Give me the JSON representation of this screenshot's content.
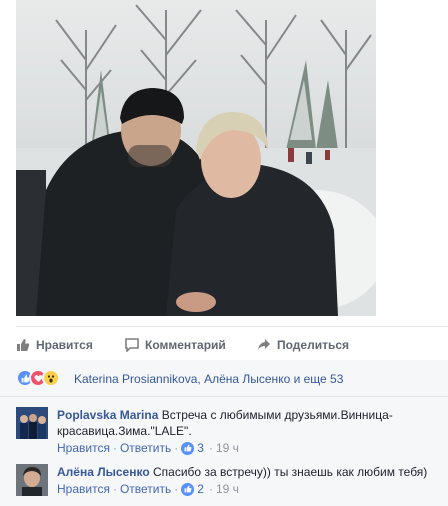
{
  "actions": {
    "like_label": "Нравится",
    "comment_label": "Комментарий",
    "share_label": "Поделиться"
  },
  "reactions": {
    "names_text": "Katerina Prosiannikova, Алёна Лысенко и еще 53",
    "types": [
      "like-icon",
      "love-icon",
      "wow-icon"
    ]
  },
  "comments": [
    {
      "author": "Poplavska Marina",
      "text": "Встреча с любимыми друзьями.Винница-красавица.Зима.\"LALE\".",
      "like_link": "Нравится",
      "reply_link": "Ответить",
      "likes_count": "3",
      "time": "19 ч"
    },
    {
      "author": "Алёна Лысенко",
      "text": "Спасибо за встречу)) ты знаешь как любим тебя)",
      "like_link": "Нравится",
      "reply_link": "Ответить",
      "likes_count": "2",
      "time": "19 ч"
    }
  ],
  "colors": {
    "link": "#365899",
    "action_text": "#616770",
    "like_blue": "#5890ff",
    "love_red": "#f25268",
    "wow_yellow": "#fcd04a"
  }
}
